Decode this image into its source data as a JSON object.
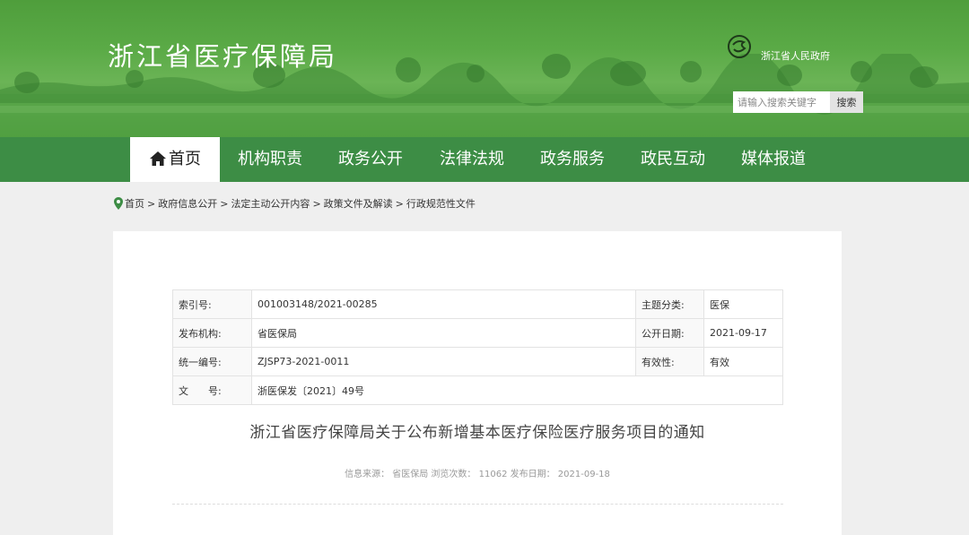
{
  "header": {
    "site_title": "浙江省医疗保障局",
    "gov_name": "浙江省人民政府",
    "logo_icon": "zhejiang-gov-logo-icon",
    "search_placeholder": "请输入搜索关键字",
    "search_label": "搜索"
  },
  "nav": {
    "items": [
      {
        "label": "首页",
        "icon": "home-icon",
        "active": true
      },
      {
        "label": "机构职责"
      },
      {
        "label": "政务公开"
      },
      {
        "label": "法律法规"
      },
      {
        "label": "政务服务"
      },
      {
        "label": "政民互动"
      },
      {
        "label": "媒体报道"
      }
    ]
  },
  "breadcrumb": {
    "icon": "location-pin-icon",
    "items": [
      "首页",
      "政府信息公开",
      "法定主动公开内容",
      "政策文件及解读",
      "行政规范性文件"
    ],
    "separator": ">"
  },
  "meta": {
    "index_label": "索引号:",
    "index_value": "001003148/2021-00285",
    "topic_label": "主题分类:",
    "topic_value": "医保",
    "issuer_label": "发布机构:",
    "issuer_value": "省医保局",
    "pubdate_label": "公开日期:",
    "pubdate_value": "2021-09-17",
    "unified_label": "统一编号:",
    "unified_value": "ZJSP73-2021-0011",
    "validity_label": "有效性:",
    "validity_value": "有效",
    "docno_label": "文　　号:",
    "docno_value": "浙医保发〔2021〕49号"
  },
  "document": {
    "title": "浙江省医疗保障局关于公布新增基本医疗保险医疗服务项目的通知",
    "info": "信息来源：  省医保局  浏览次数：  11062  发布日期：  2021-09-18"
  },
  "colors": {
    "nav_bg": "#3d8d45",
    "banner_green": "#5aaa46",
    "page_bg": "#efefef"
  }
}
